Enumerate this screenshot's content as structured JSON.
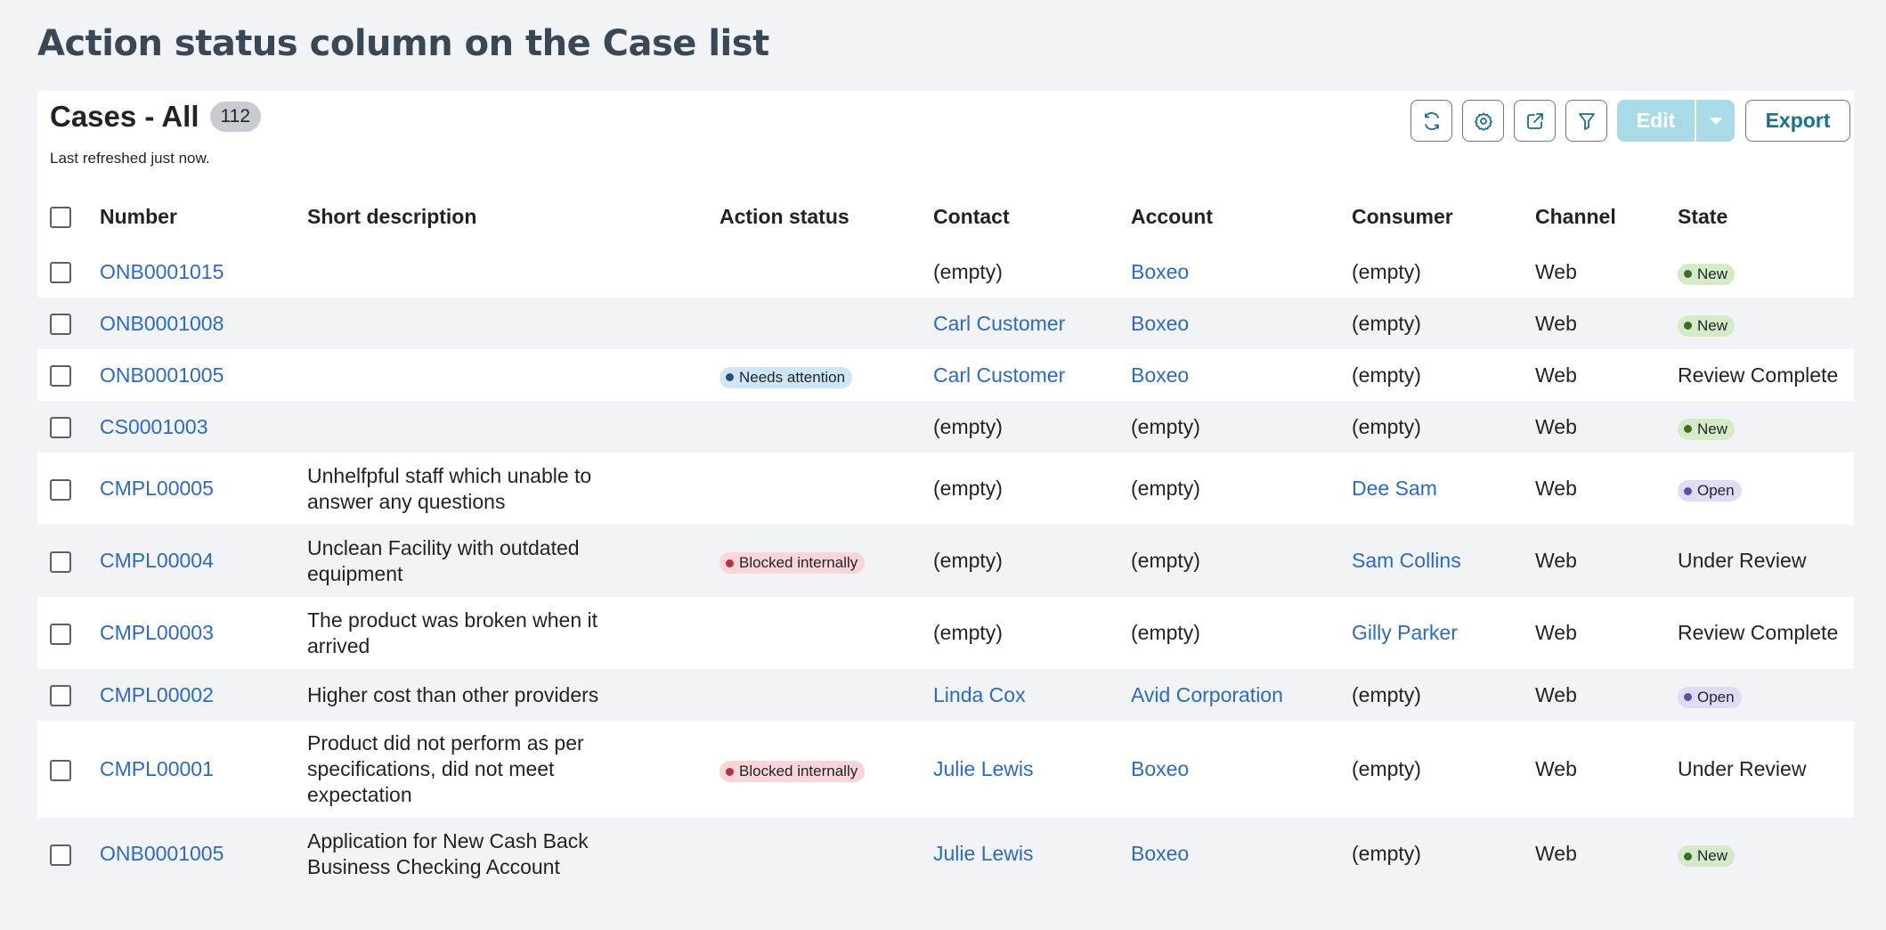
{
  "page_title": "Action status column on the Case list",
  "list": {
    "title": "Cases - All",
    "count": "112",
    "refreshed": "Last refreshed just now."
  },
  "toolbar": {
    "buttons": [
      {
        "name": "refresh-button",
        "icon": "refresh-icon"
      },
      {
        "name": "settings-button",
        "icon": "gear-icon"
      },
      {
        "name": "open-external-button",
        "icon": "external-link-icon"
      },
      {
        "name": "filter-button",
        "icon": "filter-icon"
      }
    ],
    "edit_label": "Edit",
    "export_label": "Export"
  },
  "columns": [
    "Number",
    "Short description",
    "Action status",
    "Contact",
    "Account",
    "Consumer",
    "Channel",
    "State"
  ],
  "colors": {
    "link": "#2d6ac4",
    "new_pill": "#d5eac7",
    "open_pill": "#e1dcf6",
    "attention_pill": "#cfe6f7",
    "blocked_pill": "#f8d5d6",
    "edit_button": "#a9dbe6"
  },
  "rows": [
    {
      "number": "ONB0001015",
      "desc": "",
      "action": "",
      "action_kind": "",
      "contact": "(empty)",
      "contact_link": false,
      "account": "Boxeo",
      "account_link": true,
      "consumer": "(empty)",
      "consumer_link": false,
      "channel": "Web",
      "state": "New",
      "state_kind": "new"
    },
    {
      "number": "ONB0001008",
      "desc": "",
      "action": "",
      "action_kind": "",
      "contact": "Carl Customer",
      "contact_link": true,
      "account": "Boxeo",
      "account_link": true,
      "consumer": "(empty)",
      "consumer_link": false,
      "channel": "Web",
      "state": "New",
      "state_kind": "new"
    },
    {
      "number": "ONB0001005",
      "desc": "",
      "action": "Needs attention",
      "action_kind": "attn",
      "contact": "Carl Customer",
      "contact_link": true,
      "account": "Boxeo",
      "account_link": true,
      "consumer": "(empty)",
      "consumer_link": false,
      "channel": "Web",
      "state": "Review Complete",
      "state_kind": ""
    },
    {
      "number": "CS0001003",
      "desc": "",
      "action": "",
      "action_kind": "",
      "contact": "(empty)",
      "contact_link": false,
      "account": "(empty)",
      "account_link": false,
      "consumer": "(empty)",
      "consumer_link": false,
      "channel": "Web",
      "state": "New",
      "state_kind": "new"
    },
    {
      "number": "CMPL00005",
      "desc": "Unhelfpful staff which unable to answer any questions",
      "action": "",
      "action_kind": "",
      "contact": "(empty)",
      "contact_link": false,
      "account": "(empty)",
      "account_link": false,
      "consumer": "Dee Sam",
      "consumer_link": true,
      "channel": "Web",
      "state": "Open",
      "state_kind": "open"
    },
    {
      "number": "CMPL00004",
      "desc": "Unclean Facility with outdated equipment",
      "action": "Blocked internally",
      "action_kind": "blocked",
      "contact": "(empty)",
      "contact_link": false,
      "account": "(empty)",
      "account_link": false,
      "consumer": "Sam Collins",
      "consumer_link": true,
      "channel": "Web",
      "state": "Under Review",
      "state_kind": ""
    },
    {
      "number": "CMPL00003",
      "desc": "The product was broken when it arrived",
      "action": "",
      "action_kind": "",
      "contact": "(empty)",
      "contact_link": false,
      "account": "(empty)",
      "account_link": false,
      "consumer": "Gilly Parker",
      "consumer_link": true,
      "channel": "Web",
      "state": "Review Complete",
      "state_kind": ""
    },
    {
      "number": "CMPL00002",
      "desc": "Higher cost than other providers",
      "action": "",
      "action_kind": "",
      "contact": "Linda Cox",
      "contact_link": true,
      "account": "Avid Corporation",
      "account_link": true,
      "consumer": "(empty)",
      "consumer_link": false,
      "channel": "Web",
      "state": "Open",
      "state_kind": "open"
    },
    {
      "number": "CMPL00001",
      "desc": "Product did not perform as per specifications, did not meet expectation",
      "action": "Blocked internally",
      "action_kind": "blocked",
      "contact": "Julie Lewis",
      "contact_link": true,
      "account": "Boxeo",
      "account_link": true,
      "consumer": "(empty)",
      "consumer_link": false,
      "channel": "Web",
      "state": "Under Review",
      "state_kind": ""
    },
    {
      "number": "ONB0001005",
      "desc": "Application for New Cash Back Business Checking Account",
      "action": "",
      "action_kind": "",
      "contact": "Julie Lewis",
      "contact_link": true,
      "account": "Boxeo",
      "account_link": true,
      "consumer": "(empty)",
      "consumer_link": false,
      "channel": "Web",
      "state": "New",
      "state_kind": "new"
    }
  ]
}
